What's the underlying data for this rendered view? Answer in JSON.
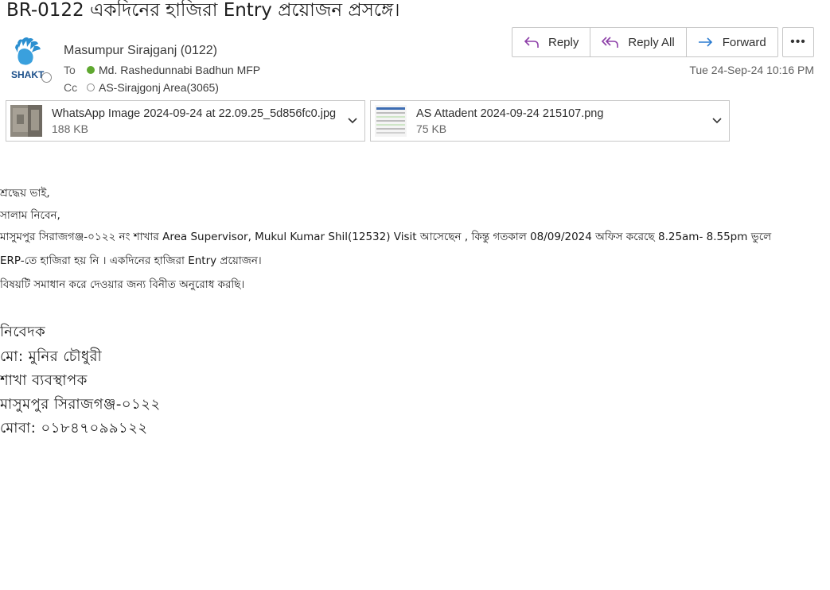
{
  "email": {
    "subject": "BR-0122 একদিনের হাজিরা Entry প্রয়োজন প্রসঙ্গে।",
    "logo_text": "SHAKT",
    "sender": "Masumpur Sirajganj (0122)",
    "to_label": "To",
    "to_value": "Md. Rashedunnabi Badhun MFP",
    "cc_label": "Cc",
    "cc_value": "AS-Sirajgonj Area(3065)",
    "date": "Tue 24-Sep-24 10:16 PM"
  },
  "actions": {
    "reply": "Reply",
    "reply_all": "Reply All",
    "forward": "Forward",
    "more": "•••"
  },
  "attachments": [
    {
      "name": "WhatsApp Image 2024-09-24 at 22.09.25_5d856fc0.jpg",
      "size": "188 KB"
    },
    {
      "name": "AS Attadent 2024-09-24 215107.png",
      "size": "75 KB"
    }
  ],
  "body": {
    "greeting": "শ্রদ্ধেয় ভাই,",
    "salam": "সালাম নিবেন,",
    "line1": "মাসুমপুর সিরাজগঞ্জ-০১২২ নং শাখার Area Supervisor, Mukul Kumar Shil(12532) Visit  আসেছেন , কিন্তু গতকাল 08/09/2024 অফিস করেছে 8.25am- 8.55pm ভুলে",
    "line2": "ERP-তে হাজিরা হয় নি । একদিনের হাজিরা Entry প্রয়োজন।",
    "line3": "বিষয়টি সমাধান করে দেওয়ার জন্য বিনীত অনুরোধ করছি।"
  },
  "signature": {
    "line1": "নিবেদক",
    "line2": "মো:  মুনির  চৌধুরী",
    "line3": "শাখা  ব্যবস্থাপক",
    "line4": "মাসুমপুর  সিরাজগঞ্জ-০১২২",
    "line5": "মোবা:  ০১৮৪৭০৯৯১২২"
  }
}
